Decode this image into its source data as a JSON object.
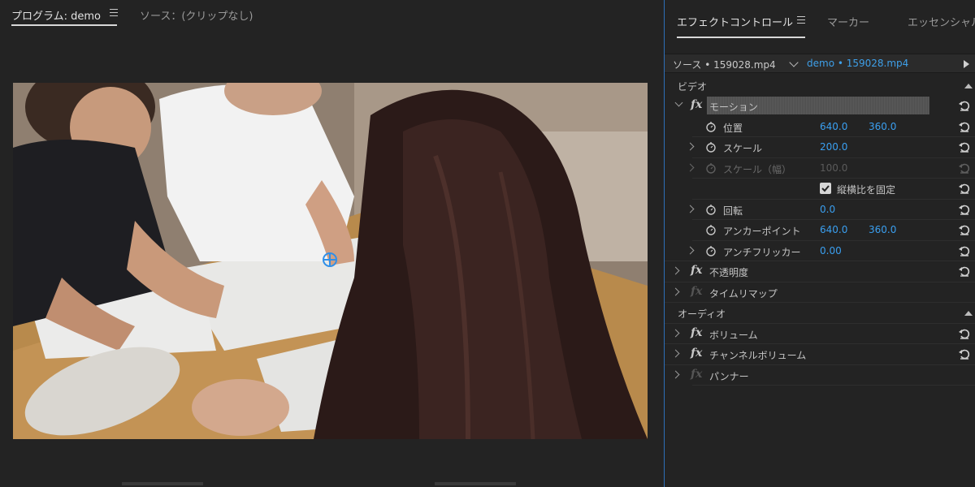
{
  "program": {
    "tab_active": "プログラム: demo",
    "tab_source": "ソース：(クリップなし)"
  },
  "effects": {
    "tabs": [
      "エフェクトコントロール",
      "マーカー",
      "エッセンシャル"
    ],
    "source_label": "ソース • 159028.mp4",
    "sequence_label": "demo • 159028.mp4",
    "video_section": "ビデオ",
    "audio_section": "オーディオ",
    "motion": "モーション",
    "position_label": "位置",
    "position_x": "640.0",
    "position_y": "360.0",
    "scale_label": "スケール",
    "scale_value": "200.0",
    "scale_width_label": "スケール（幅）",
    "scale_width_value": "100.0",
    "uniform_scale_label": "縦横比を固定",
    "rotation_label": "回転",
    "rotation_value": "0.0",
    "anchor_label": "アンカーポイント",
    "anchor_x": "640.0",
    "anchor_y": "360.0",
    "flicker_label": "アンチフリッカー",
    "flicker_value": "0.00",
    "opacity": "不透明度",
    "time_remap": "タイムリマップ",
    "volume": "ボリューム",
    "channel_volume": "チャンネルボリューム",
    "panner": "パンナー"
  },
  "colors": {
    "accent_blue": "#3a9ff0",
    "panel_bg": "#232323"
  }
}
